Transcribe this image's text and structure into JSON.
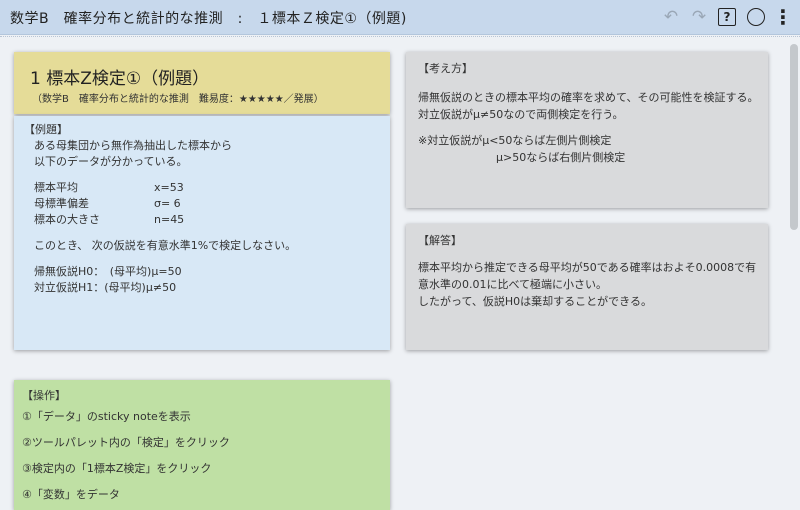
{
  "header": {
    "title": "数学B　確率分布と統計的な推測　:　１標本Ｚ検定①（例題)",
    "undo_icon": "undo-icon",
    "redo_icon": "redo-icon",
    "help_label": "?",
    "menu_label": "⋮"
  },
  "heading_card": {
    "title": "1 標本Z検定①（例題）",
    "subtitle": "（数学B　確率分布と統計的な推測　難易度：★★★★★／発展）"
  },
  "example_card": {
    "label": "【例題】",
    "intro_1": "ある母集団から無作為抽出した標本から",
    "intro_2": "以下のデータが分かっている。",
    "rows": [
      {
        "label": "標本平均",
        "value": "x=53"
      },
      {
        "label": "母標準偏差",
        "value": "σ= 6"
      },
      {
        "label": "標本の大きさ",
        "value": "n=45"
      }
    ],
    "question": "このとき、 次の仮説を有意水準1%で検定しなさい。",
    "h0": "帰無仮説H0：　(母平均)μ=50",
    "h1": "対立仮説H1：(母平均)μ≠50"
  },
  "approach_card": {
    "label": "【考え方】",
    "line1": "帰無仮説のときの標本平均の確率を求めて、その可能性を検証する。",
    "line2": "対立仮説がμ≠50なので両側検定を行う。",
    "note1": "※対立仮説がμ<50ならば左側片側検定",
    "note2": "μ>50ならば右側片側検定"
  },
  "answer_card": {
    "label": "【解答】",
    "line1": " 標本平均から推定できる母平均が50である確率はおよそ0.0008で有",
    "line2": "意水準の0.01に比べて極端に小さい。",
    "line3": "したがって、仮説H0は棄却することができる。"
  },
  "operation_card": {
    "label": "【操作】",
    "steps": [
      "①「データ」のsticky noteを表示",
      "②ツールパレット内の「検定」をクリック",
      "③検定内の「1標本Z検定」をクリック",
      "④「変数」をデータ"
    ]
  }
}
